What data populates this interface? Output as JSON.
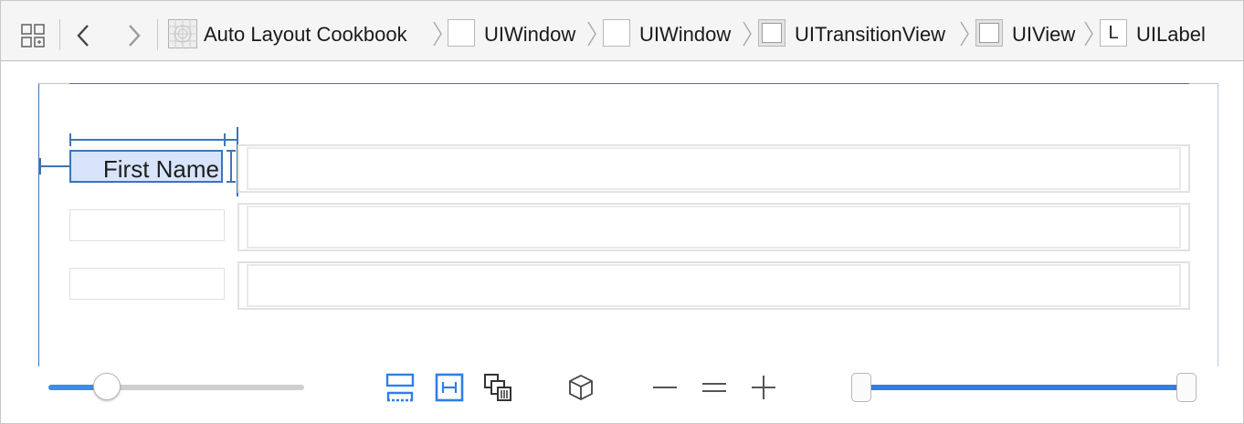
{
  "jump_bar": {
    "breadcrumbs": [
      {
        "label": "Auto Layout Cookbook",
        "icon": "storyboard-icon"
      },
      {
        "label": "UIWindow",
        "icon": "window-icon"
      },
      {
        "label": "UIWindow",
        "icon": "window-icon"
      },
      {
        "label": "UITransitionView",
        "icon": "view-icon"
      },
      {
        "label": "UIView",
        "icon": "view-icon"
      },
      {
        "label": "UILabel",
        "icon": "label-icon",
        "icon_glyph": "L"
      }
    ]
  },
  "canvas": {
    "selected_label": "First Name",
    "form_rows": 3
  },
  "bottom_bar": {
    "zoom_slider_level": 0.23,
    "range_slider_start": 0.0,
    "range_slider_end": 1.0,
    "accent_color": "#2f7fe6"
  }
}
